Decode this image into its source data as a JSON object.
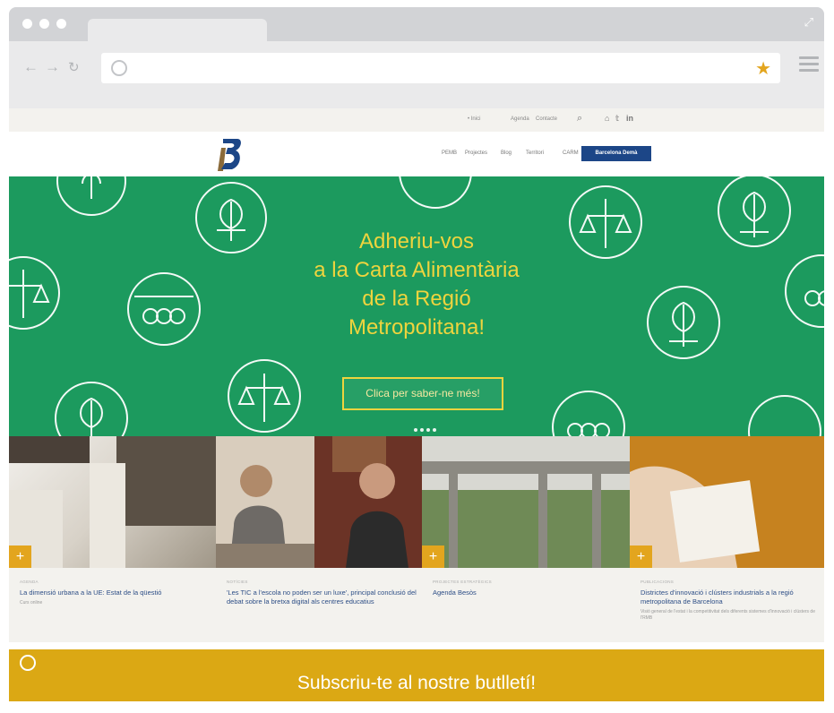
{
  "browser": {
    "back_icon": "arrow-left-icon",
    "forward_icon": "arrow-right-icon",
    "reload_icon": "reload-icon",
    "url": "",
    "star_color": "#e3a51e"
  },
  "utility_bar": {
    "home_label": "• Inici",
    "agenda_label": "Agenda",
    "contact_label": "Contacte",
    "search_icon": "search-icon",
    "social": [
      "rss-icon",
      "twitter-icon",
      "linkedin-icon"
    ]
  },
  "header": {
    "nav": [
      "PEMB",
      "Projectes",
      "Blog",
      "Territori",
      "CARM"
    ],
    "cta_label": "Barcelona Demà",
    "cta_color": "#1c4687"
  },
  "hero": {
    "lines": [
      "Adheriu-vos",
      "a la Carta Alimentària",
      "de la Regió",
      "Metropolitana!"
    ],
    "button_label": "Clica per saber-ne més!",
    "text_color": "#eed43e",
    "background": "#1c9a5e",
    "slide_count": 4
  },
  "photos": [
    {
      "description": "architecture-photo"
    },
    {
      "description": "video-call-photo-1"
    },
    {
      "description": "video-call-photo-2"
    },
    {
      "description": "bridge-photo"
    },
    {
      "description": "hand-papers-photo"
    }
  ],
  "cards": [
    {
      "kicker": "Agenda",
      "title": "La dimensió urbana a la UE: Estat de la qüestió",
      "sub": "Curs online"
    },
    {
      "kicker": "Notícies",
      "title": "'Les TIC a l'escola no poden ser un luxe', principal conclusió del debat sobre la bretxa digital als centres educatius",
      "sub": ""
    },
    {
      "kicker": "Projectes estratègics",
      "title": "Agenda Besòs",
      "sub": ""
    },
    {
      "kicker": "Publicacions",
      "title": "Districtes d'innovació i clústers industrials a la regió metropolitana de Barcelona",
      "sub": "Visió general de l'estat i la competitivitat dels diferents sistemes d'innovació i clústers de l'RMB"
    }
  ],
  "subscribe": {
    "label": "Subscriu-te al nostre butlletí!",
    "icon": "mail-icon",
    "color": "#dba814"
  }
}
